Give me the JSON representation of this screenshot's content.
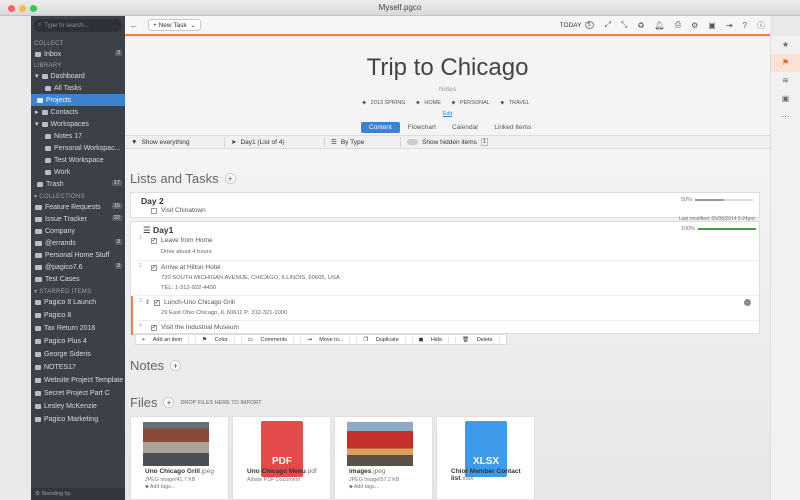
{
  "window": {
    "title": "Myself.pgco"
  },
  "sidebar": {
    "search_placeholder": "Type to search...",
    "sections": {
      "collect": "COLLECT",
      "library": "LIBRARY",
      "collections": "COLLECTIONS",
      "starred": "STARRED ITEMS"
    },
    "inbox": {
      "label": "Inbox",
      "count": "3"
    },
    "library_items": [
      "Dashboard",
      "All Tasks",
      "Projects",
      "Contacts",
      "Workspaces",
      "Notes 17",
      "Personal Workspac...",
      "Test Workspace",
      "Work",
      "Trash"
    ],
    "trash_count": "17",
    "collections": [
      {
        "label": "Feature Requests",
        "count": "15"
      },
      {
        "label": "Issue Tracker",
        "count": "22"
      },
      {
        "label": "Company",
        "count": ""
      },
      {
        "label": "@errands",
        "count": "3"
      },
      {
        "label": "Personal Home Stuff",
        "count": ""
      },
      {
        "label": "@pagico7.6",
        "count": "3"
      },
      {
        "label": "Test Cases",
        "count": ""
      }
    ],
    "starred": [
      "Pagico 8 Launch",
      "Pagico 8",
      "Tax Return 2016",
      "Pagico Plus 4",
      "George Sideris",
      "NOTES17",
      "Website Project Template",
      "Secret Project Part C",
      "Lesley McKenzie",
      "Pagico Marketing"
    ],
    "status": "Standing by."
  },
  "toolbar": {
    "new_task": "New Task",
    "today": "TODAY",
    "today_badge": "5"
  },
  "project": {
    "title": "Trip to Chicago",
    "notes_placeholder": "Notes",
    "tags": [
      "2013 SPRING",
      "HOME",
      "PERSONAL",
      "TRAVEL"
    ],
    "edit_label": "Edit",
    "tabs": [
      "Content",
      "Flowchart",
      "Calendar",
      "Linked Items"
    ]
  },
  "filters": {
    "show": "Show everything",
    "day": "Day1 (List of 4)",
    "by_type": "By Type",
    "hidden": "Show hidden items",
    "hidden_count": "1"
  },
  "lists": {
    "header": "Lists and Tasks",
    "day2": {
      "title": "Day 2",
      "progress": "50%",
      "progress_value": 0.5,
      "task": "Visit Chinatown"
    },
    "day1": {
      "title": "Day1",
      "modified": "Last modified: 05/08/2014 5:24pm",
      "progress": "100%",
      "progress_value": 1.0,
      "tasks": [
        {
          "num": "1",
          "title": "Leave from Home",
          "note": "Drive about 4 hours"
        },
        {
          "num": "2",
          "title": "Arrive at Hilton Hotel",
          "note": "720 SOUTH MICHIGAN AVENUE, CHICAGO, ILLINOIS, 60605, USA",
          "note2": "TEL: 1-312-922-4400"
        },
        {
          "num": "3",
          "title": "Lunch-Uno Chicago Grill",
          "note": "29 East Ohio Chicago, IL 60611 P: 312-321-1000"
        },
        {
          "num": "4",
          "title": "Visit the Industrial Museum"
        }
      ]
    },
    "actions": [
      "Add an item",
      "Color",
      "Comments",
      "Move to...",
      "Duplicate",
      "Hide",
      "Delete"
    ]
  },
  "notes": {
    "header": "Notes"
  },
  "files": {
    "header": "Files",
    "drop_hint": "DROP FILES HERE TO IMPORT",
    "items": [
      {
        "name": "Uno Chicago Grill",
        "ext": ".jpeg",
        "meta": "JPEG Image/41.7 KB",
        "tags": "Add tags..."
      },
      {
        "name": "Uno Chicago Menu",
        "ext": ".pdf",
        "meta": "Adobe PDF Document",
        "tags": "",
        "badge": "PDF"
      },
      {
        "name": "images",
        "ext": ".jpeg",
        "meta": "JPEG Image/57.2 KB",
        "tags": "Add tags..."
      },
      {
        "name": "Chior Member Contact list",
        "ext": ".xlsx",
        "meta": "",
        "tags": "",
        "badge": "XLSX"
      }
    ]
  },
  "colors": {
    "accent": "#3d82d0",
    "orange": "#e8844a",
    "sidebar": "#3c4148",
    "pdf": "#e44a4a",
    "xlsx": "#3d9be9",
    "done": "#3ca33c"
  }
}
